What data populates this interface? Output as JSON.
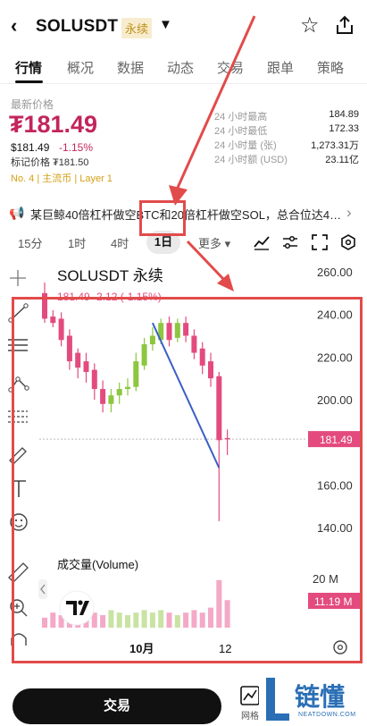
{
  "header": {
    "back_icon": "back-chevron-icon",
    "symbol": "SOLUSDT",
    "perp_badge": "永续",
    "caret_icon": "caret-down-icon",
    "favorite_icon": "star-outline-icon",
    "share_icon": "share-icon"
  },
  "tabs": [
    {
      "label": "行情",
      "active": true
    },
    {
      "label": "概况"
    },
    {
      "label": "数据"
    },
    {
      "label": "动态"
    },
    {
      "label": "交易"
    },
    {
      "label": "跟单"
    },
    {
      "label": "策略"
    }
  ],
  "price": {
    "latest_label": "最新价格",
    "main": "₮181.49",
    "usd": "$181.49",
    "change_pct": "-1.15%",
    "mark": "标记价格 ₮181.50",
    "tags": "No. 4  |  主流币  |  Layer 1"
  },
  "stats": [
    {
      "k": "24 小时最高",
      "v": "184.89"
    },
    {
      "k": "24 小时最低",
      "v": "172.33"
    },
    {
      "k": "24 小时量 (张)",
      "v": "1,273.31万"
    },
    {
      "k": "24 小时额 (USD)",
      "v": "23.11亿"
    }
  ],
  "news": {
    "icon": "megaphone-icon",
    "text": "某巨鲸40倍杠杆做空BTC和20倍杠杆做空SOL，总合位达4…",
    "chevron_icon": "chevron-right-icon"
  },
  "intervals": {
    "items": [
      "15分",
      "1时",
      "4时",
      "1日"
    ],
    "active": "1日",
    "more": "更多 ▾",
    "tools": [
      "indicator-icon",
      "settings-sliders-icon",
      "fullscreen-icon",
      "hexagon-settings-icon"
    ]
  },
  "chart": {
    "title": "SOLUSDT 永续",
    "ohlc_line": "181.49  -2.12  (-1.15%)",
    "current_price_tag": "181.49",
    "volume_label": "成交量(Volume)",
    "volume_axis": "20 M",
    "volume_tag": "11.19 M",
    "x_labels": [
      "10月",
      "12"
    ],
    "drawing_tools": [
      "crosshair-icon",
      "trendline-icon",
      "horizontal-lines-icon",
      "node-icon",
      "fib-icon",
      "brush-icon",
      "text-icon",
      "emoji-icon",
      "ruler-icon",
      "zoom-in-icon",
      "magnet-icon"
    ],
    "settings_icon": "gear-icon",
    "collapse_icon": "chevron-left-icon",
    "brand_icon": "tradingview-logo-icon"
  },
  "chart_data": {
    "type": "candlestick",
    "title": "SOLUSDT 永续",
    "y_axis_ticks": [
      260,
      240,
      220,
      200,
      180,
      160,
      140
    ],
    "ylim": [
      130,
      265
    ],
    "x_ticks": [
      "10月",
      "12"
    ],
    "colors": {
      "up": "#8dc63f",
      "down": "#e34b7e"
    },
    "candles": [
      {
        "o": 250,
        "c": 238,
        "h": 255,
        "l": 236
      },
      {
        "o": 239,
        "c": 236,
        "h": 242,
        "l": 234
      },
      {
        "o": 238,
        "c": 228,
        "h": 241,
        "l": 225
      },
      {
        "o": 230,
        "c": 218,
        "h": 233,
        "l": 214
      },
      {
        "o": 222,
        "c": 215,
        "h": 224,
        "l": 210
      },
      {
        "o": 218,
        "c": 213,
        "h": 222,
        "l": 208
      },
      {
        "o": 214,
        "c": 205,
        "h": 217,
        "l": 200
      },
      {
        "o": 205,
        "c": 198,
        "h": 209,
        "l": 194
      },
      {
        "o": 198,
        "c": 202,
        "h": 205,
        "l": 194
      },
      {
        "o": 202,
        "c": 205,
        "h": 208,
        "l": 198
      },
      {
        "o": 205,
        "c": 206,
        "h": 210,
        "l": 202
      },
      {
        "o": 206,
        "c": 218,
        "h": 222,
        "l": 204
      },
      {
        "o": 216,
        "c": 226,
        "h": 229,
        "l": 214
      },
      {
        "o": 226,
        "c": 230,
        "h": 234,
        "l": 223
      },
      {
        "o": 228,
        "c": 236,
        "h": 238,
        "l": 226
      },
      {
        "o": 236,
        "c": 228,
        "h": 239,
        "l": 225
      },
      {
        "o": 229,
        "c": 236,
        "h": 238,
        "l": 227
      },
      {
        "o": 236,
        "c": 230,
        "h": 239,
        "l": 227
      },
      {
        "o": 230,
        "c": 222,
        "h": 233,
        "l": 219
      },
      {
        "o": 224,
        "c": 216,
        "h": 227,
        "l": 212
      },
      {
        "o": 218,
        "c": 210,
        "h": 222,
        "l": 206
      },
      {
        "o": 211,
        "c": 181,
        "h": 213,
        "l": 143
      },
      {
        "o": 182,
        "c": 181.49,
        "h": 186,
        "l": 174
      }
    ],
    "volume": [
      4,
      6,
      5,
      7,
      4,
      5,
      6,
      5,
      7,
      6,
      5,
      6,
      7,
      6,
      7,
      6,
      5,
      6,
      7,
      6,
      8,
      19,
      11
    ],
    "trendline": {
      "from_index": 13,
      "from_value": 236,
      "to_index": 21,
      "to_value": 168,
      "color": "#3b5fc8"
    },
    "last_price": 181.49,
    "volume_unit": "M"
  }
}
